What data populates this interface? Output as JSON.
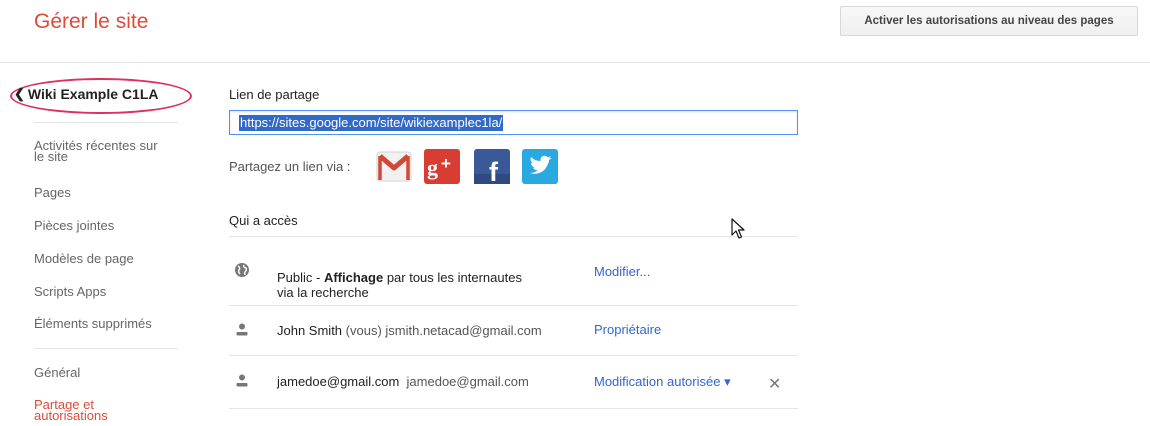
{
  "header": {
    "title": "Gérer le site",
    "page_permissions_button": "Activer les autorisations au niveau des pages"
  },
  "sidebar": {
    "site_name": "Wiki Example C1LA",
    "back_icon": "chevron-left-icon",
    "items": [
      {
        "label": "Activités récentes sur\nle site"
      },
      {
        "label": "Pages"
      },
      {
        "label": "Pièces jointes"
      },
      {
        "label": "Modèles de page"
      },
      {
        "label": "Scripts Apps"
      },
      {
        "label": "Éléments supprimés"
      },
      {
        "label": "Général"
      },
      {
        "label": "Partage et\nautorisations",
        "active": true
      }
    ],
    "active_color": "#dd4b39"
  },
  "sharing": {
    "link_label": "Lien de partage",
    "link_url": "https://sites.google.com/site/wikiexamplec1la/",
    "share_via_label": "Partagez un lien via :",
    "share_icons": [
      "gmail-icon",
      "google-plus-icon",
      "facebook-icon",
      "twitter-icon"
    ],
    "access_label": "Qui a accès",
    "rows": [
      {
        "icon": "globe-icon",
        "name_prefix": "Public - ",
        "name_bold": "Affichage",
        "name_suffix": " par tous les internautes\nvia la recherche",
        "action": "Modifier..."
      },
      {
        "icon": "person-icon",
        "name": "John Smith",
        "qualifier": " (vous)",
        "email": " jsmith.netacad@gmail.com",
        "action": "Propriétaire"
      },
      {
        "icon": "person-icon",
        "name": "jamedoe@gmail.com",
        "email": "jamedoe@gmail.com",
        "action": "Modification autorisée ▾",
        "remove": "✕"
      }
    ]
  },
  "colors": {
    "accent": "#dd4b39",
    "link": "#3366cc",
    "selection": "#3169c6",
    "annotation": "#e03060"
  }
}
